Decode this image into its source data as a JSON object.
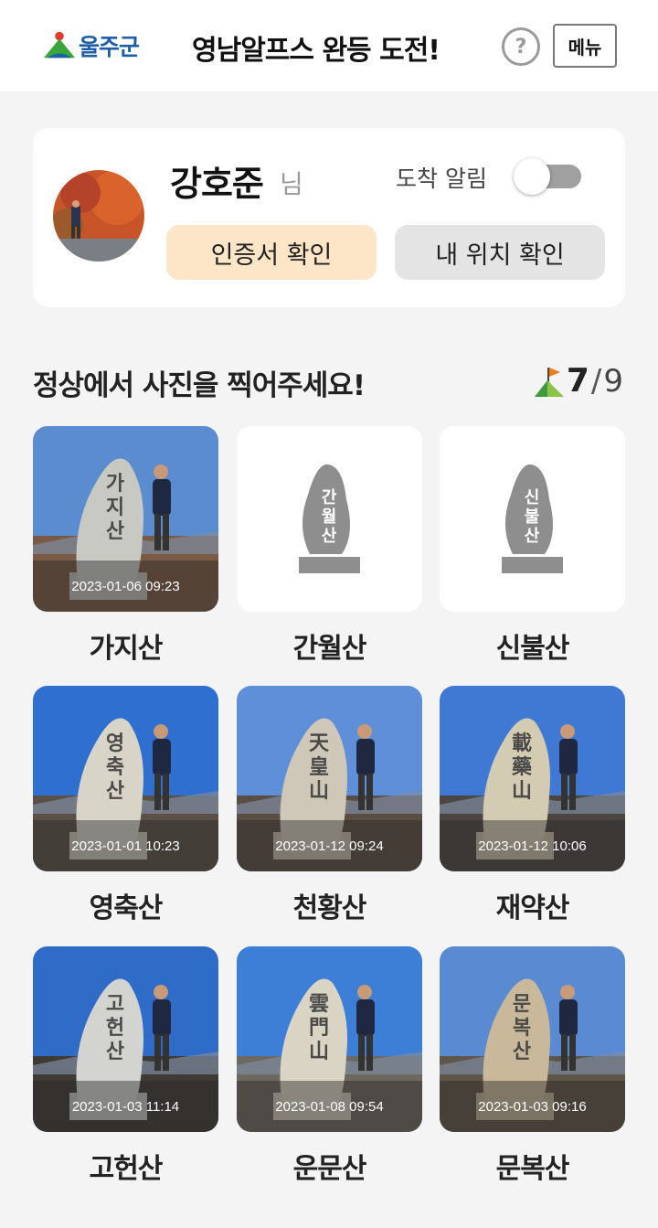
{
  "header": {
    "logo_text": "울주군",
    "title": "영남알프스 완등 도전!",
    "help_label": "?",
    "menu_label": "메뉴"
  },
  "profile": {
    "name": "강호준",
    "honorific": "님",
    "arrival_alert_label": "도착 알림",
    "arrival_alert_on": false,
    "certificate_button": "인증서 확인",
    "location_button": "내 위치 확인"
  },
  "section": {
    "title": "정상에서 사진을 찍어주세요!",
    "completed": "7",
    "separator": "/",
    "total": "9"
  },
  "mountains": [
    {
      "name": "가지산",
      "timestamp": "2023-01-06 09:23",
      "stone_label": "가지산",
      "done": true
    },
    {
      "name": "간월산",
      "timestamp": "",
      "stone_label": "간월산",
      "done": false
    },
    {
      "name": "신불산",
      "timestamp": "",
      "stone_label": "신불산",
      "done": false
    },
    {
      "name": "영축산",
      "timestamp": "2023-01-01 10:23",
      "stone_label": "영축산",
      "done": true
    },
    {
      "name": "천황산",
      "timestamp": "2023-01-12 09:24",
      "stone_label": "天皇山",
      "done": true
    },
    {
      "name": "재약산",
      "timestamp": "2023-01-12 10:06",
      "stone_label": "載藥山",
      "done": true
    },
    {
      "name": "고헌산",
      "timestamp": "2023-01-03 11:14",
      "stone_label": "고헌산",
      "done": true
    },
    {
      "name": "운문산",
      "timestamp": "2023-01-08 09:54",
      "stone_label": "雲門山",
      "done": true
    },
    {
      "name": "문복산",
      "timestamp": "2023-01-03 09:16",
      "stone_label": "문복산",
      "done": true
    }
  ],
  "colors": {
    "cert_button_bg": "#fde5c8",
    "location_button_bg": "#e4e4e4",
    "logo_blue": "#1f5fa8",
    "logo_green": "#3aa53a",
    "logo_red": "#e23b2e",
    "sky": "#3d7fd6"
  }
}
